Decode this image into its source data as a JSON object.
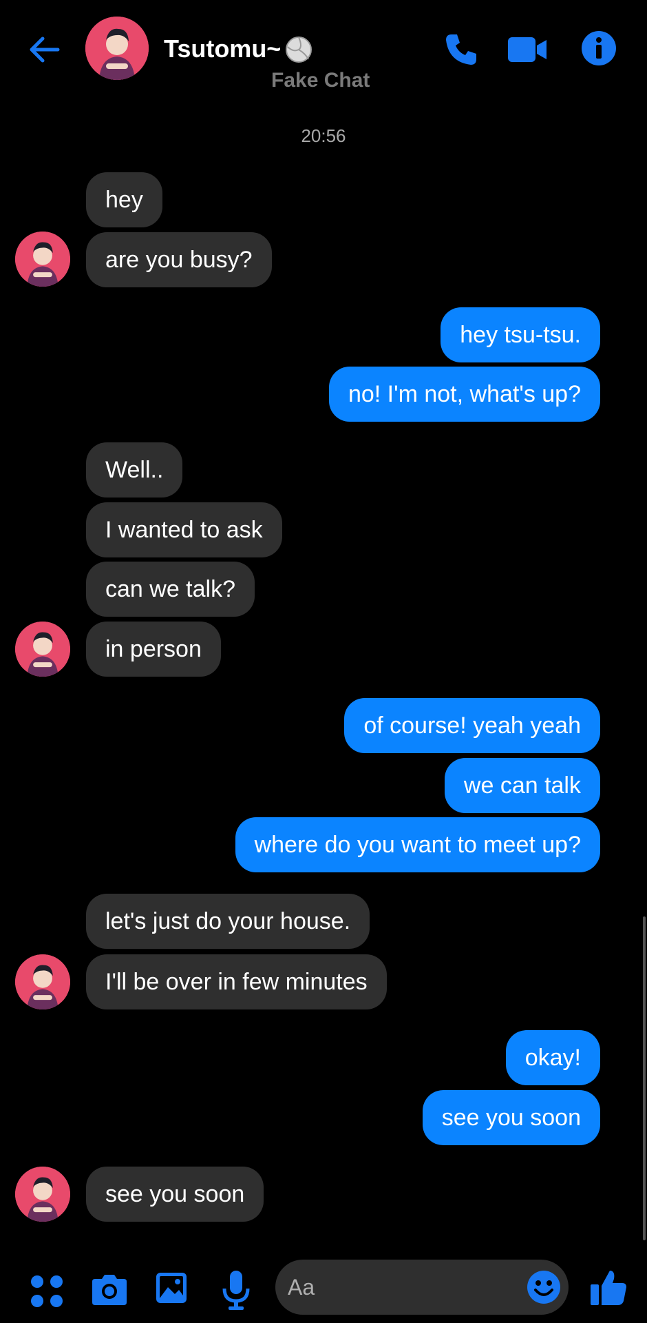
{
  "header": {
    "contact_name": "Tsutomu~",
    "subtitle": "Fake Chat",
    "icons": [
      "back-arrow-icon",
      "volleyball-icon",
      "phone-icon",
      "video-camera-icon",
      "info-icon"
    ],
    "accent_color": "#1877f2"
  },
  "timestamp": "20:56",
  "messages": [
    {
      "side": "in",
      "text": "hey"
    },
    {
      "side": "in",
      "text": "are you busy?"
    },
    {
      "side": "out",
      "text": "hey tsu-tsu."
    },
    {
      "side": "out",
      "text": "no! I'm not, what's up?"
    },
    {
      "side": "in",
      "text": "Well.."
    },
    {
      "side": "in",
      "text": "I wanted to ask"
    },
    {
      "side": "in",
      "text": "can we talk?"
    },
    {
      "side": "in",
      "text": "in person"
    },
    {
      "side": "out",
      "text": "of course! yeah yeah"
    },
    {
      "side": "out",
      "text": "we can talk"
    },
    {
      "side": "out",
      "text": "where do you want to meet up?"
    },
    {
      "side": "in",
      "text": "let's just do your house."
    },
    {
      "side": "in",
      "text": "I'll be over in few minutes"
    },
    {
      "side": "out",
      "text": "okay!"
    },
    {
      "side": "out",
      "text": "see you soon"
    },
    {
      "side": "in",
      "text": "see you soon"
    }
  ],
  "composer": {
    "placeholder": "Aa",
    "icons": [
      "apps-grid-icon",
      "camera-icon",
      "image-icon",
      "microphone-icon",
      "emoji-icon",
      "thumbs-up-icon"
    ]
  },
  "colors": {
    "incoming_bubble": "#2f2f2f",
    "outgoing_bubble": "#0b84ff",
    "background": "#000000"
  }
}
